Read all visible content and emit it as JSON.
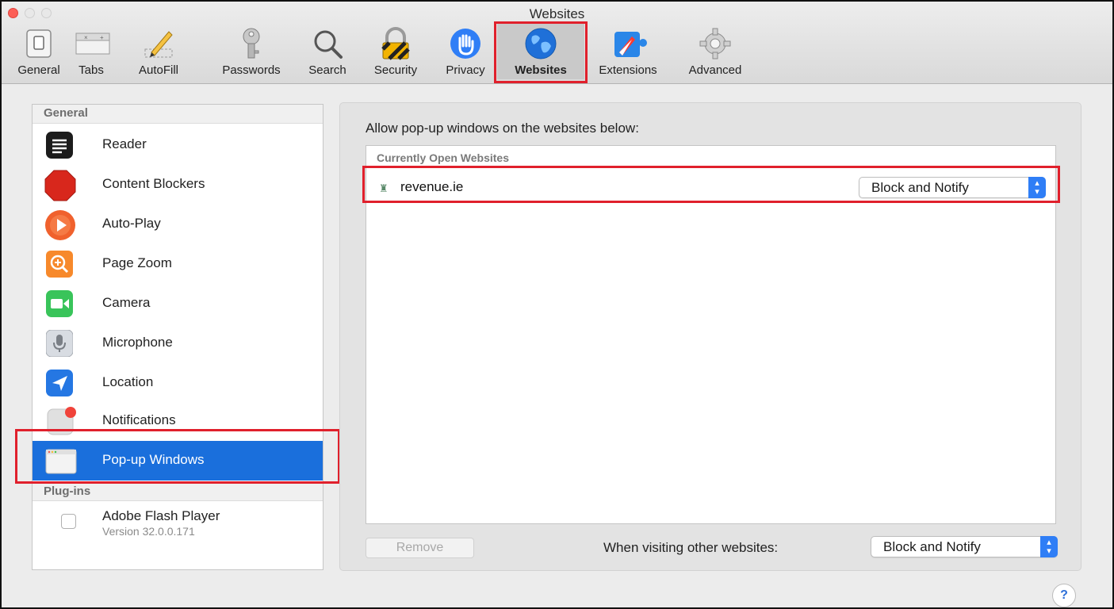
{
  "window": {
    "title": "Websites",
    "traffic_lights": {
      "close_color": "#fc5f57"
    }
  },
  "toolbar": {
    "tabs": [
      {
        "label": "General",
        "icon": "general-switch-icon"
      },
      {
        "label": "Tabs",
        "icon": "tabs-icon"
      },
      {
        "label": "AutoFill",
        "icon": "pencil-icon"
      },
      {
        "label": "Passwords",
        "icon": "key-icon"
      },
      {
        "label": "Search",
        "icon": "magnifier-icon"
      },
      {
        "label": "Security",
        "icon": "padlock-icon"
      },
      {
        "label": "Privacy",
        "icon": "hand-icon"
      },
      {
        "label": "Websites",
        "icon": "globe-icon",
        "selected": true
      },
      {
        "label": "Extensions",
        "icon": "puzzle-compass-icon"
      },
      {
        "label": "Advanced",
        "icon": "gear-icon"
      }
    ]
  },
  "sidebar": {
    "general_header": "General",
    "items": [
      {
        "label": "Reader",
        "icon": "reader-icon"
      },
      {
        "label": "Content Blockers",
        "icon": "stop-sign-icon"
      },
      {
        "label": "Auto-Play",
        "icon": "play-icon"
      },
      {
        "label": "Page Zoom",
        "icon": "zoom-icon"
      },
      {
        "label": "Camera",
        "icon": "camera-icon"
      },
      {
        "label": "Microphone",
        "icon": "microphone-icon"
      },
      {
        "label": "Location",
        "icon": "location-arrow-icon"
      },
      {
        "label": "Notifications",
        "icon": "notifications-icon"
      },
      {
        "label": "Pop-up Windows",
        "icon": "popup-windows-icon",
        "selected": true
      }
    ],
    "plugins_header": "Plug-ins",
    "plugin": {
      "name": "Adobe Flash Player",
      "version": "Version 32.0.0.171",
      "checked": false
    }
  },
  "main": {
    "heading": "Allow pop-up windows on the websites below:",
    "table_header": "Currently Open Websites",
    "sites": [
      {
        "name": "revenue.ie",
        "setting": "Block and Notify"
      }
    ],
    "remove_label": "Remove",
    "other_label": "When visiting other websites:",
    "other_setting": "Block and Notify",
    "help_label": "?"
  },
  "colors": {
    "selection": "#1a6fdc",
    "popup_arrow": "#2f7ef6",
    "highlight": "#e0202c"
  }
}
